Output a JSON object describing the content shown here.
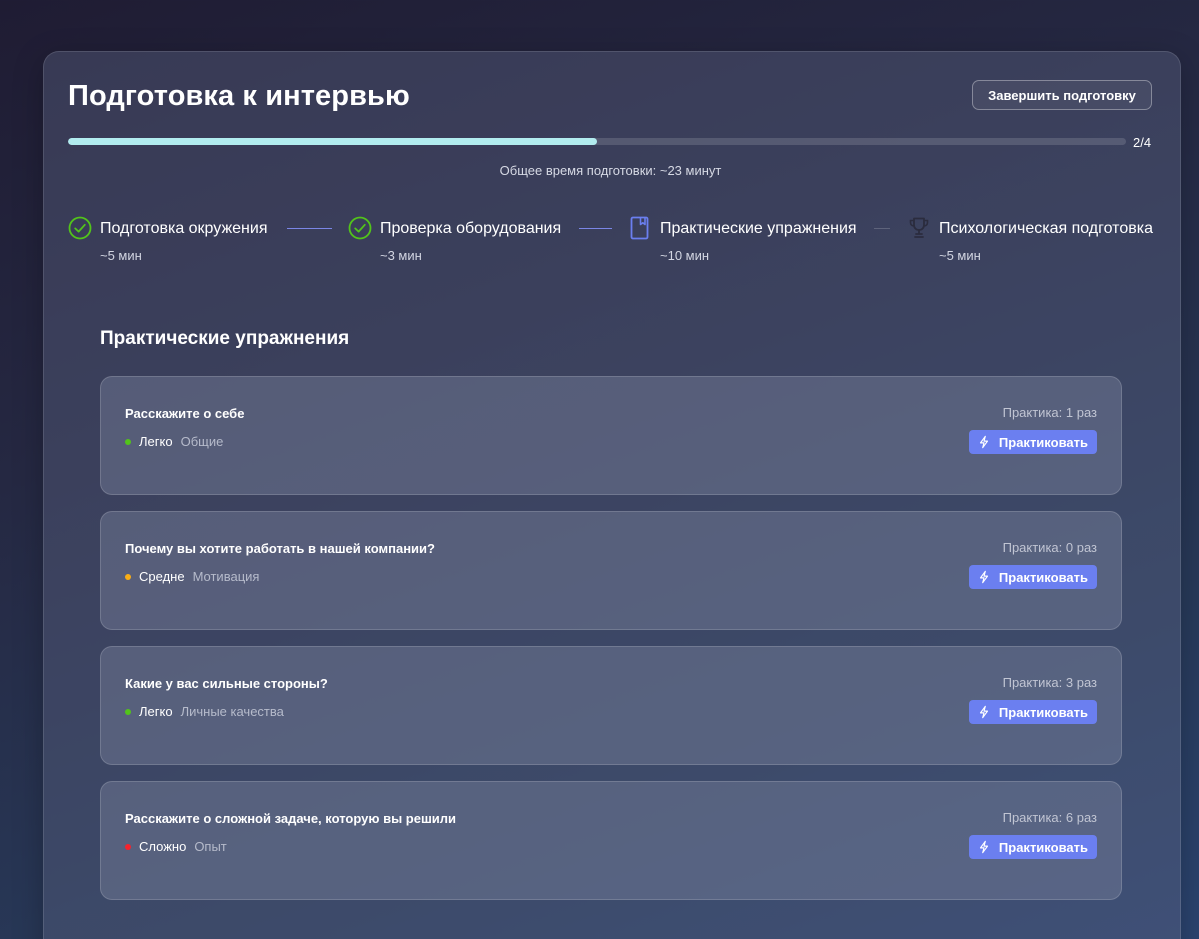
{
  "header": {
    "title": "Подготовка к интервью",
    "finish_label": "Завершить подготовку"
  },
  "progress": {
    "completed": 2,
    "total": 4,
    "fraction": 0.5,
    "label": "2/4",
    "total_time": "Общее время подготовки: ~23 минут",
    "fill_color": "#b2ecef"
  },
  "steps": [
    {
      "label": "Подготовка окружения",
      "duration": "~5 мин",
      "status": "completed",
      "icon": "check-circle-icon"
    },
    {
      "label": "Проверка оборудования",
      "duration": "~3 мин",
      "status": "completed",
      "icon": "check-circle-icon"
    },
    {
      "label": "Практические упражнения",
      "duration": "~10 мин",
      "status": "current",
      "icon": "book-icon"
    },
    {
      "label": "Психологическая подготовка",
      "duration": "~5 мин",
      "status": "pending",
      "icon": "trophy-icon"
    }
  ],
  "section": {
    "title": "Практические упражнения"
  },
  "exercises": [
    {
      "question": "Расскажите о себе",
      "level": "Легко",
      "level_color": "#52c41a",
      "category": "Общие",
      "count": "Практика: 1 раз",
      "button": "Практиковать"
    },
    {
      "question": "Почему вы хотите работать в нашей компании?",
      "level": "Средне",
      "level_color": "#faad14",
      "category": "Мотивация",
      "count": "Практика: 0 раз",
      "button": "Практиковать"
    },
    {
      "question": "Какие у вас сильные стороны?",
      "level": "Легко",
      "level_color": "#52c41a",
      "category": "Личные качества",
      "count": "Практика: 3 раз",
      "button": "Практиковать"
    },
    {
      "question": "Расскажите о сложной задаче, которую вы решили",
      "level": "Сложно",
      "level_color": "#f5222d",
      "category": "Опыт",
      "count": "Практика: 6 раз",
      "button": "Практиковать"
    }
  ],
  "colors": {
    "accent": "#6b7ff0",
    "success": "#52c41a",
    "connector_done": "#7b86e6"
  }
}
